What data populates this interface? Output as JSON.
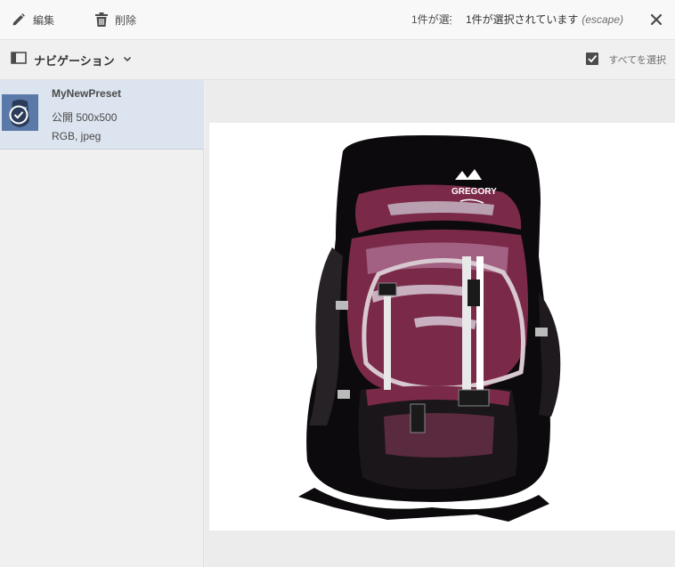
{
  "toolbar": {
    "edit_label": "編集",
    "delete_label": "削除",
    "truncated_text": "1件が選択されています",
    "selection_text": "1件が選択されています",
    "escape_hint": "(escape)"
  },
  "navbar": {
    "title": "ナビゲーション",
    "select_all_label": "すべてを選択"
  },
  "preset": {
    "name": "MyNewPreset",
    "size": "公開 500x500",
    "format": "RGB, jpeg"
  },
  "preview": {
    "logo_text": "GREGORY"
  },
  "colors": {
    "accent": "#5b79a8",
    "selected_row": "#dce4ef",
    "pack_body": "#0c0a0c",
    "pack_maroon": "#7a2a48"
  }
}
